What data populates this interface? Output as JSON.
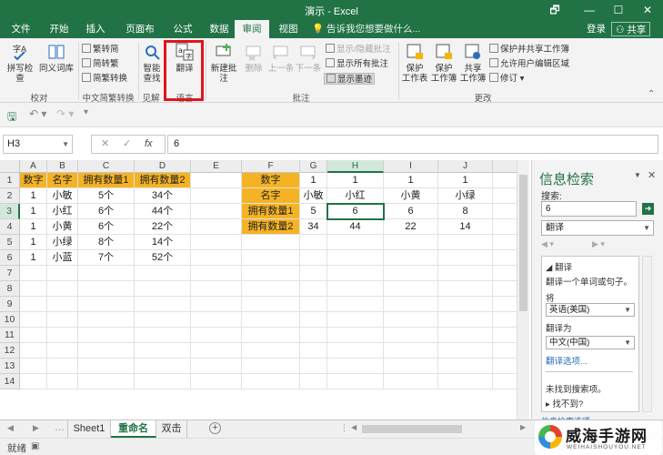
{
  "window": {
    "title": "演示 - Excel",
    "minimize": "🗗",
    "restore": "—",
    "maximize": "☐",
    "close": "✕"
  },
  "tabs": [
    "文件",
    "开始",
    "插入",
    "页面布局",
    "公式",
    "数据",
    "审阅",
    "视图"
  ],
  "active_tab": "审阅",
  "tell_me": "告诉我您想要做什么...",
  "account": {
    "login": "登录",
    "share": "共享"
  },
  "ribbon": {
    "proofing": {
      "label": "校对",
      "spellcheck": "拼写检查",
      "thesaurus": "同义词库"
    },
    "chinese_conversion": {
      "label": "中文简繁转换",
      "to_simplified": "繁转简",
      "to_traditional": "简转繁",
      "convert": "简繁转换"
    },
    "insights": {
      "label": "见解",
      "smart_lookup_1": "智能",
      "smart_lookup_2": "查找"
    },
    "language": {
      "label": "语言",
      "translate": "翻译"
    },
    "comments": {
      "label": "批注",
      "new": "新建批注",
      "delete": "删除",
      "prev": "上一条",
      "next": "下一条",
      "show_hide": "显示/隐藏批注",
      "show_all": "显示所有批注",
      "show_ink": "显示墨迹"
    },
    "changes": {
      "label": "更改",
      "protect_sheet_1": "保护",
      "protect_sheet_2": "工作表",
      "protect_wb_1": "保护",
      "protect_wb_2": "工作簿",
      "share_wb_1": "共享",
      "share_wb_2": "工作簿",
      "protect_share": "保护并共享工作簿",
      "allow_edit": "允许用户编辑区域",
      "track": "修订"
    }
  },
  "formula_bar": {
    "name_box": "H3",
    "cancel": "✕",
    "enter": "✓",
    "fx": "fx",
    "content": "6"
  },
  "columns": [
    "A",
    "B",
    "C",
    "D",
    "E",
    "F",
    "G",
    "H",
    "I",
    "J"
  ],
  "selected_column": "H",
  "rows": [
    "1",
    "2",
    "3",
    "4",
    "5",
    "6",
    "7",
    "8",
    "9",
    "10",
    "11",
    "12",
    "13",
    "14"
  ],
  "selected_row": "3",
  "table1": {
    "headers": [
      "数字",
      "名字",
      "拥有数量1",
      "拥有数量2"
    ],
    "rows": [
      [
        "1",
        "小敏",
        "5个",
        "34个"
      ],
      [
        "1",
        "小红",
        "6个",
        "44个"
      ],
      [
        "1",
        "小黄",
        "6个",
        "22个"
      ],
      [
        "1",
        "小绿",
        "8个",
        "14个"
      ],
      [
        "1",
        "小蓝",
        "7个",
        "52个"
      ]
    ]
  },
  "table2": {
    "row_headers": [
      "数字",
      "名字",
      "拥有数量1",
      "拥有数量2"
    ],
    "rows": [
      [
        "1",
        "1",
        "1",
        "1"
      ],
      [
        "小敏",
        "小红",
        "小黄",
        "小绿"
      ],
      [
        "5",
        "6",
        "6",
        "8"
      ],
      [
        "34",
        "44",
        "22",
        "14"
      ]
    ]
  },
  "research_pane": {
    "title": "信息检索",
    "search_label": "搜索:",
    "search_value": "6",
    "source": "翻译",
    "section": "翻译",
    "desc": "翻译一个单词或句子。",
    "from_label": "将",
    "from_lang": "英语(美国)",
    "to_label": "翻译为",
    "to_lang": "中文(中国)",
    "options_link": "翻译选项...",
    "not_found": "未找到搜索项。",
    "cant_find": "找不到?",
    "bottom_link": "信息检索选项..."
  },
  "sheets": [
    "Sheet1",
    "重命名",
    "双击"
  ],
  "active_sheet": "重命名",
  "status": "就绪",
  "watermark": {
    "name": "威海手游网",
    "sub": "WEIHAISHOUYOU.NET"
  },
  "colors": {
    "accent": "#217346",
    "header_fill": "#f5b324",
    "highlight": "#e0141c"
  }
}
